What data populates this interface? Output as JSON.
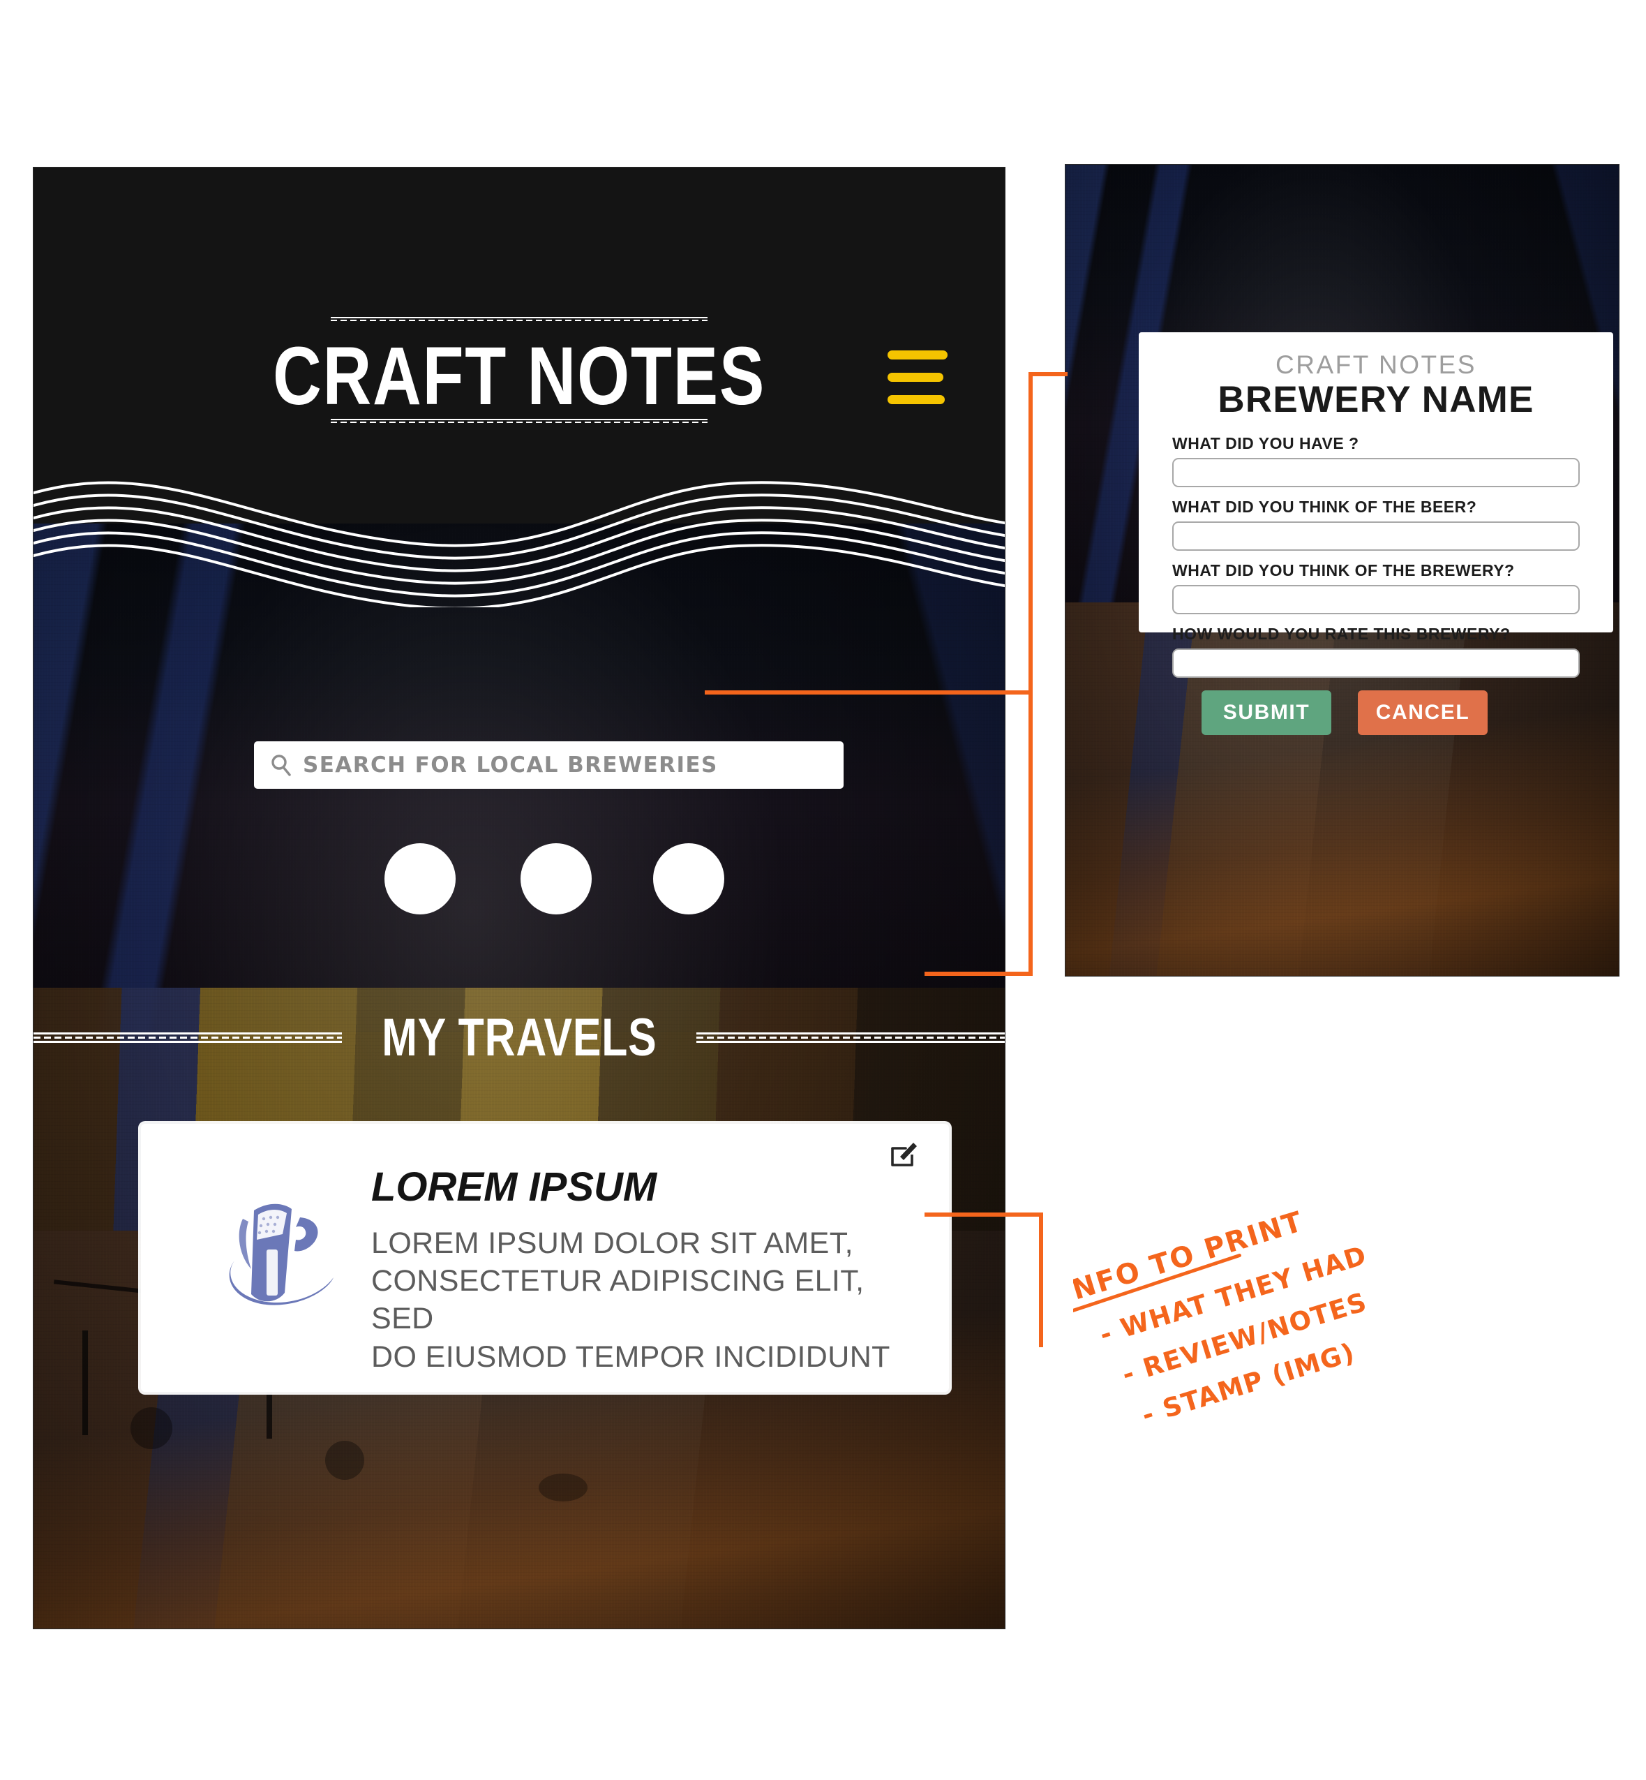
{
  "app": {
    "title": "CRAFT NOTES",
    "menu_icon": "hamburger-icon",
    "accent_yellow": "#F5C400",
    "accent_orange": "#F4651C",
    "header_bg": "#141414",
    "panel_bg": "#0f0f0f"
  },
  "search": {
    "placeholder": "SEARCH FOR LOCAL BREWERIES",
    "icon": "search-icon"
  },
  "avatars": [
    {
      "name": "avatar-placeholder-1"
    },
    {
      "name": "avatar-placeholder-2"
    },
    {
      "name": "avatar-placeholder-3"
    }
  ],
  "travels": {
    "section_title": "MY TRAVELS",
    "card": {
      "title": "LOREM IPSUM",
      "body": "LOREM IPSUM DOLOR SIT AMET,\nCONSECTETUR ADIPISCING ELIT, SED\nDO EIUSMOD TEMPOR INCIDIDUNT",
      "edit_icon": "edit-pencil-icon",
      "stamp_icon": "beer-stamp-icon",
      "stamp_color": "#6B78B8"
    }
  },
  "modal": {
    "eyebrow": "CRAFT NOTES",
    "title": "BREWERY NAME",
    "fields": [
      {
        "label": "WHAT DID YOU HAVE ?",
        "value": "",
        "placeholder": ""
      },
      {
        "label": "WHAT DID YOU THINK OF THE BEER?",
        "value": "",
        "placeholder": ""
      },
      {
        "label": "WHAT DID YOU THINK OF THE BREWERY?",
        "value": "",
        "placeholder": ""
      },
      {
        "label": "HOW WOULD YOU RATE THIS BREWERY?",
        "value": "",
        "placeholder": ""
      }
    ],
    "submit_label": "SUBMIT",
    "cancel_label": "CANCEL",
    "submit_color": "#5FA57F",
    "cancel_color": "#E0714A"
  },
  "annotation": {
    "heading": "INFO TO PRINT",
    "items": [
      "- WHAT THEY HAD",
      "- REVIEW/NOTES",
      "- STAMP (IMG)"
    ],
    "color": "#F4651C"
  }
}
